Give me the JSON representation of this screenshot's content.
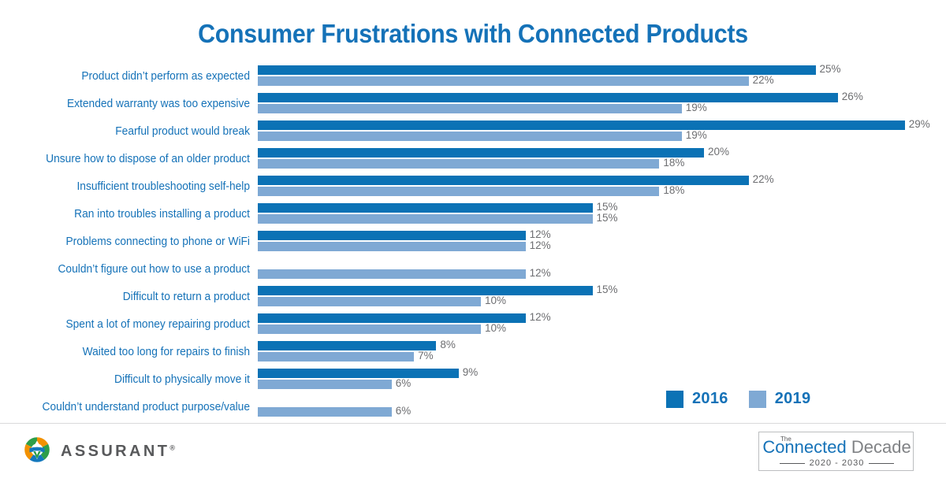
{
  "title": "Consumer Frustrations with Connected Products",
  "legend": {
    "items": [
      {
        "label": "2016",
        "color": "#0b72b5"
      },
      {
        "label": "2019",
        "color": "#7fa9d4"
      }
    ]
  },
  "footer": {
    "brand_name": "ASSURANT",
    "brand_reg": "®",
    "badge": {
      "the": "The",
      "connected": "Connected",
      "decade": " Decade",
      "years": "2020  -  2030"
    }
  },
  "chart_data": {
    "type": "bar",
    "orientation": "horizontal",
    "title": "Consumer Frustrations with Connected Products",
    "xlabel": "",
    "ylabel": "",
    "xlim": [
      0,
      29
    ],
    "grid": false,
    "legend_position": "bottom-right",
    "value_suffix": "%",
    "categories": [
      "Product didn’t perform as expected",
      "Extended warranty was too expensive",
      "Fearful product would break",
      "Unsure how to dispose of an older product",
      "Insufficient troubleshooting self-help",
      "Ran into troubles installing a product",
      "Problems connecting to phone or WiFi",
      "Couldn’t figure out how to use a product",
      "Difficult to return a product",
      "Spent a lot of money repairing product",
      "Waited too long for repairs to finish",
      "Difficult to physically move it",
      "Couldn’t understand product purpose/value"
    ],
    "series": [
      {
        "name": "2016",
        "color": "#0b72b5",
        "values": [
          25,
          26,
          29,
          20,
          22,
          15,
          12,
          null,
          15,
          12,
          8,
          9,
          null
        ],
        "labels": [
          "25%",
          "26%",
          "29%",
          "20%",
          "22%",
          "15%",
          "12%",
          "",
          "15%",
          "12%",
          "8%",
          "9%",
          ""
        ]
      },
      {
        "name": "2019",
        "color": "#7fa9d4",
        "values": [
          22,
          19,
          19,
          18,
          18,
          15,
          12,
          12,
          10,
          10,
          7,
          6,
          6
        ],
        "labels": [
          "22%",
          "19%",
          "19%",
          "18%",
          "18%",
          "15%",
          "12%",
          "12%",
          "10%",
          "10%",
          "7%",
          "6%",
          "6%"
        ]
      }
    ]
  }
}
